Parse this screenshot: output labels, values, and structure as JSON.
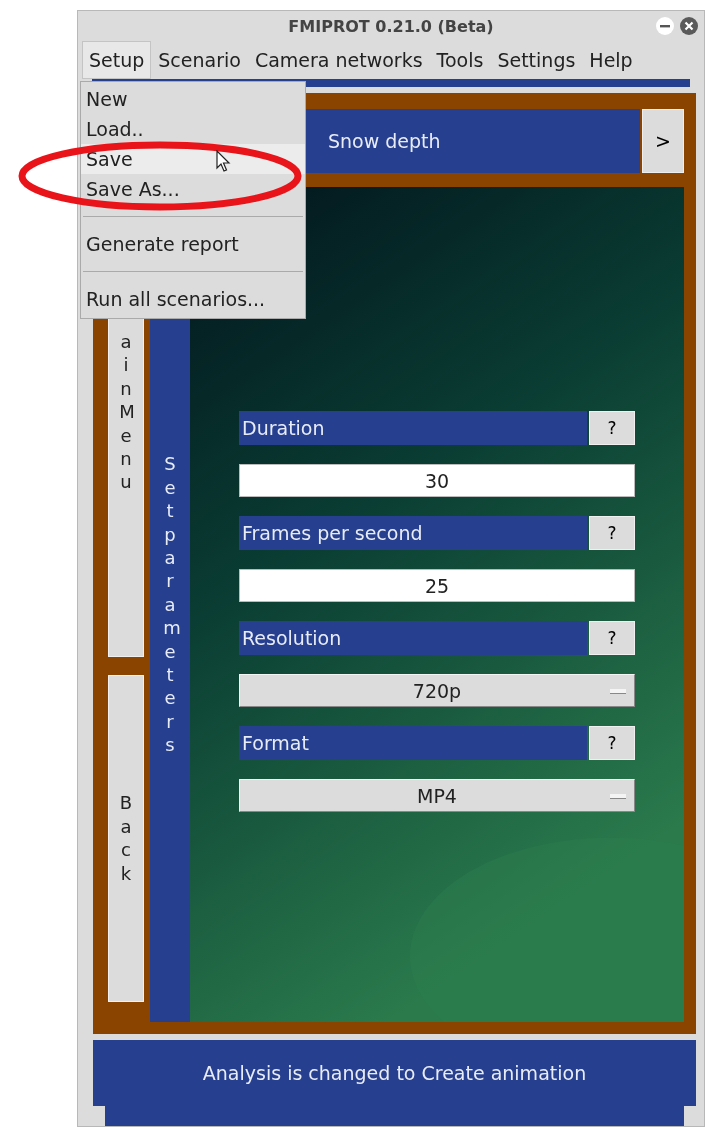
{
  "window": {
    "title": "FMIPROT 0.21.0 (Beta)"
  },
  "menubar": [
    {
      "label": "Setup",
      "selected": true
    },
    {
      "label": "Scenario",
      "selected": false
    },
    {
      "label": "Camera networks",
      "selected": false
    },
    {
      "label": "Tools",
      "selected": false
    },
    {
      "label": "Settings",
      "selected": false
    },
    {
      "label": "Help",
      "selected": false
    }
  ],
  "setup_menu": [
    {
      "kind": "item",
      "label": "New",
      "selected": false
    },
    {
      "kind": "item",
      "label": "Load..",
      "selected": false
    },
    {
      "kind": "item",
      "label": "Save",
      "selected": true
    },
    {
      "kind": "item",
      "label": "Save As...",
      "selected": false
    },
    {
      "kind": "separator"
    },
    {
      "kind": "item",
      "label": "Generate report",
      "selected": false
    },
    {
      "kind": "separator"
    },
    {
      "kind": "item",
      "label": "Run all scenarios...",
      "selected": false
    }
  ],
  "scenario_bar": {
    "title": "Snow depth",
    "next_button": ">"
  },
  "side_buttons": [
    "ainMenu",
    "Back"
  ],
  "section_label": "Setparameters",
  "parameters": [
    {
      "label": "Duration",
      "help": "?",
      "kind": "entry",
      "value": "30"
    },
    {
      "label": "Frames per second",
      "help": "?",
      "kind": "entry",
      "value": "25"
    },
    {
      "label": "Resolution",
      "help": "?",
      "kind": "dropdown",
      "value": "720p"
    },
    {
      "label": "Format",
      "help": "?",
      "kind": "dropdown",
      "value": "MP4"
    }
  ],
  "status_bar": "Analysis is changed to Create animation"
}
